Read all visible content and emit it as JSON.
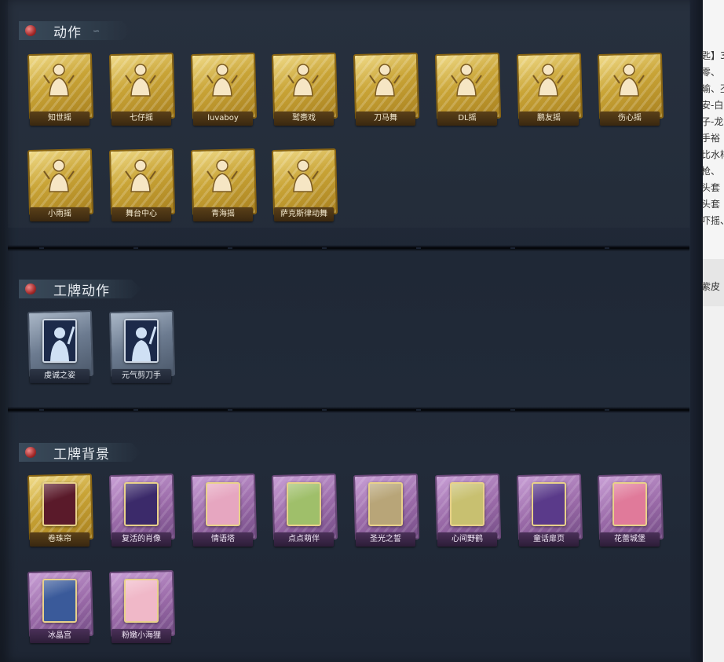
{
  "sections": [
    {
      "title": "动作",
      "style": "gold",
      "items": [
        {
          "label": "知世摇",
          "icon": "pose-figure-icon"
        },
        {
          "label": "七仔摇",
          "icon": "pose-figure-icon"
        },
        {
          "label": "luvaboy",
          "icon": "pose-figure-icon"
        },
        {
          "label": "鹫赉戏",
          "icon": "pose-figure-icon"
        },
        {
          "label": "刀马舞",
          "icon": "pose-figure-icon"
        },
        {
          "label": "DL摇",
          "icon": "pose-figure-icon"
        },
        {
          "label": "鹏友摇",
          "icon": "pose-figure-icon"
        },
        {
          "label": "伤心摇",
          "icon": "pose-figure-icon"
        },
        {
          "label": "小雨摇",
          "icon": "pose-figure-icon"
        },
        {
          "label": "舞台中心",
          "icon": "pose-figure-icon"
        },
        {
          "label": "青海摇",
          "icon": "pose-figure-icon"
        },
        {
          "label": "萨克斯律动舞",
          "icon": "pose-figure-icon"
        }
      ]
    },
    {
      "title": "工牌动作",
      "style": "blue",
      "items": [
        {
          "label": "虔诚之姿",
          "icon": "badge-silhouette-icon"
        },
        {
          "label": "元气剪刀手",
          "icon": "badge-silhouette-icon"
        }
      ]
    },
    {
      "title": "工牌背景",
      "style": "purple",
      "items": [
        {
          "label": "卷珠帘",
          "icon": "card-background-icon",
          "tile": "gold",
          "card": "#5a1a2a"
        },
        {
          "label": "复活的肖像",
          "icon": "card-background-icon",
          "tile": "purple",
          "card": "#3b2a6a"
        },
        {
          "label": "情语塔",
          "icon": "card-background-icon",
          "tile": "purple",
          "card": "#e6a6c0"
        },
        {
          "label": "点点萌伴",
          "icon": "card-background-icon",
          "tile": "purple",
          "card": "#9fbf6a"
        },
        {
          "label": "圣光之誓",
          "icon": "card-background-icon",
          "tile": "purple",
          "card": "#b8a578"
        },
        {
          "label": "心间野鹤",
          "icon": "card-background-icon",
          "tile": "purple",
          "card": "#c8c070"
        },
        {
          "label": "童话扉页",
          "icon": "card-background-icon",
          "tile": "purple",
          "card": "#5a3a8a"
        },
        {
          "label": "花蕾城堡",
          "icon": "card-background-icon",
          "tile": "purple",
          "card": "#e07a9a"
        },
        {
          "label": "冰晶宫",
          "icon": "card-background-icon",
          "tile": "purple",
          "card": "#3a5a9a"
        },
        {
          "label": "粉嫩小海狸",
          "icon": "card-background-icon",
          "tile": "purple",
          "card": "#f0b8c8"
        }
      ]
    }
  ],
  "side_text": [
    "匙】3",
    "零、",
    "瑜、丕",
    "安-白",
    "子-龙",
    "手裕",
    "比水样",
    "枪、",
    "头套",
    "头套",
    "吓摇、",
    "紫皮"
  ],
  "colors": {
    "gold": "#c9a436",
    "purple": "#9a6aa8",
    "blue": "#6c7b90",
    "background": "#222b39"
  }
}
